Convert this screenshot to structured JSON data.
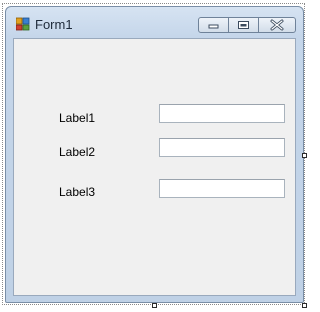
{
  "window": {
    "title": "Form1",
    "icon": "winforms-form-icon",
    "buttons": {
      "minimize": "minimize-icon",
      "maximize": "maximize-icon",
      "close": "close-icon"
    }
  },
  "form": {
    "fields": [
      {
        "label": "Label1",
        "value": ""
      },
      {
        "label": "Label2",
        "value": ""
      },
      {
        "label": "Label3",
        "value": ""
      }
    ]
  },
  "colors": {
    "client_background": "#f0f0f0",
    "title_bar": "#c5d6ea",
    "selection_handle": "#2b2b2b"
  }
}
